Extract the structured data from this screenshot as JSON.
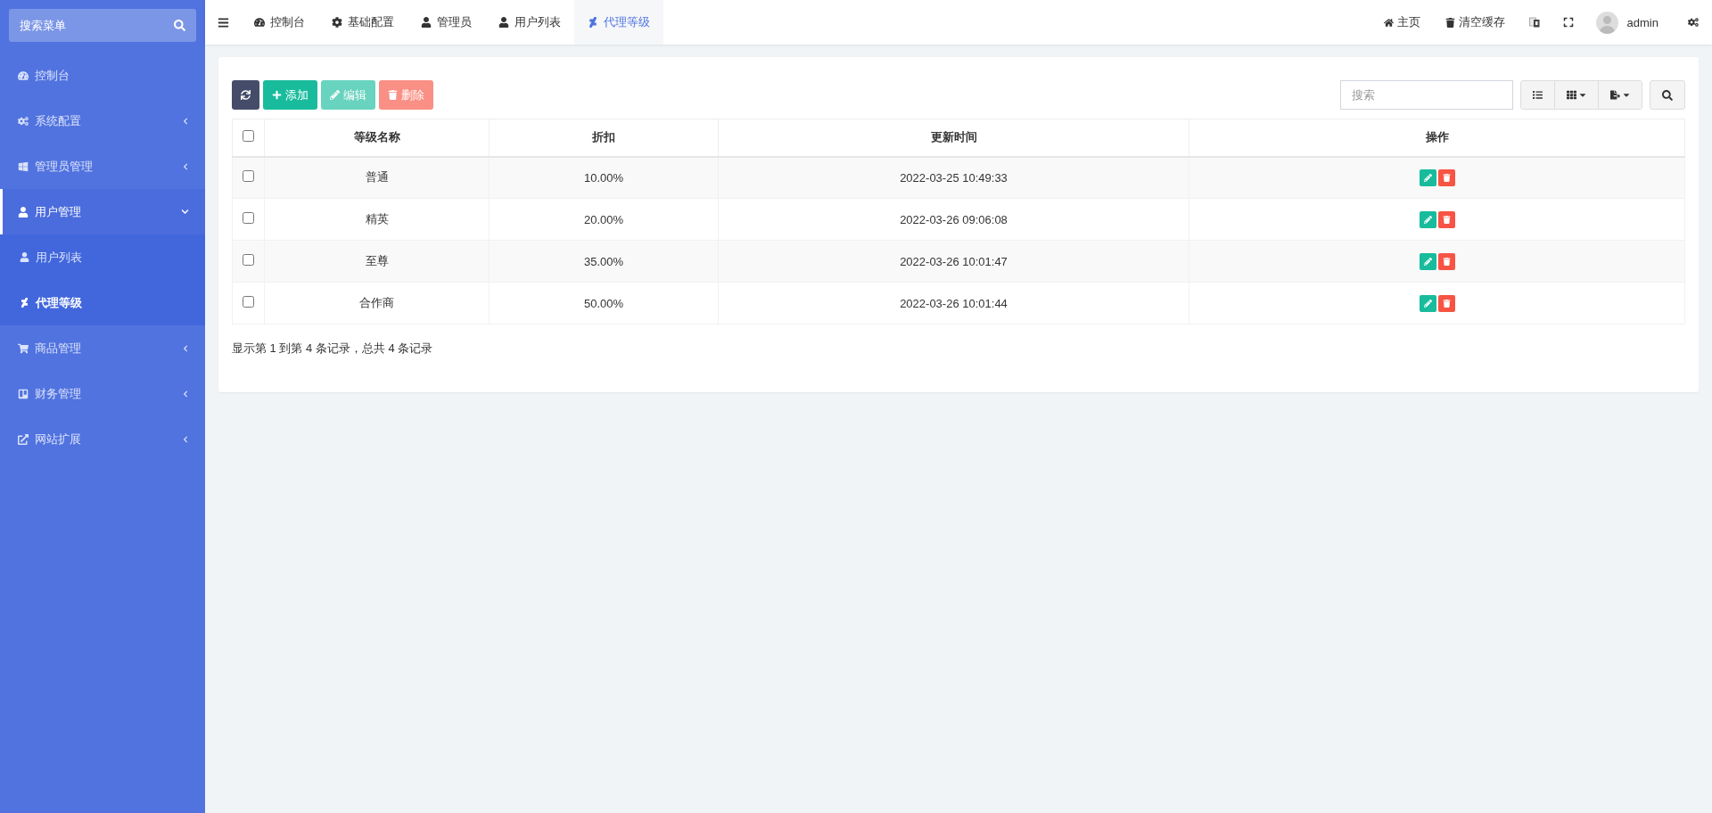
{
  "sidebar": {
    "search": {
      "placeholder": "搜索菜单"
    },
    "items": [
      {
        "label": "控制台",
        "kind": "link",
        "selected": false
      },
      {
        "label": "系统配置",
        "kind": "group",
        "selected": false,
        "expanded": false
      },
      {
        "label": "管理员管理",
        "kind": "group",
        "selected": false,
        "expanded": false
      },
      {
        "label": "用户管理",
        "kind": "group",
        "selected": true,
        "expanded": true,
        "children": [
          {
            "label": "用户列表",
            "selected": false
          },
          {
            "label": "代理等级",
            "selected": true
          }
        ]
      },
      {
        "label": "商品管理",
        "kind": "group",
        "selected": false,
        "expanded": false
      },
      {
        "label": "财务管理",
        "kind": "group",
        "selected": false,
        "expanded": false
      },
      {
        "label": "网站扩展",
        "kind": "group",
        "selected": false,
        "expanded": false
      }
    ]
  },
  "tabs": [
    {
      "label": "控制台",
      "selected": false
    },
    {
      "label": "基础配置",
      "selected": false
    },
    {
      "label": "管理员",
      "selected": false
    },
    {
      "label": "用户列表",
      "selected": false
    },
    {
      "label": "代理等级",
      "selected": true
    }
  ],
  "header_right": {
    "home": "主页",
    "clear_cache": "清空缓存",
    "user": "admin"
  },
  "toolbar": {
    "buttons": [
      {
        "kind": "refresh",
        "disabled": false
      },
      {
        "kind": "add",
        "label": "添加",
        "disabled": false
      },
      {
        "kind": "edit",
        "label": "编辑",
        "disabled": true
      },
      {
        "kind": "delete",
        "label": "删除",
        "disabled": true
      }
    ],
    "search": {
      "placeholder": "搜索"
    }
  },
  "table": {
    "columns": [
      "等级名称",
      "折扣",
      "更新时间",
      "操作"
    ],
    "all_checked": false,
    "rows": [
      {
        "selected": false,
        "cells": [
          "普通",
          "10.00%",
          "2022-03-25 10:49:33"
        ]
      },
      {
        "selected": false,
        "cells": [
          "精英",
          "20.00%",
          "2022-03-26 09:06:08"
        ]
      },
      {
        "selected": false,
        "cells": [
          "至尊",
          "35.00%",
          "2022-03-26 10:01:47"
        ]
      },
      {
        "selected": false,
        "cells": [
          "合作商",
          "50.00%",
          "2022-03-26 10:01:44"
        ]
      }
    ]
  },
  "pagination_info": "显示第 1 到第 4 条记录，总共 4 条记录"
}
